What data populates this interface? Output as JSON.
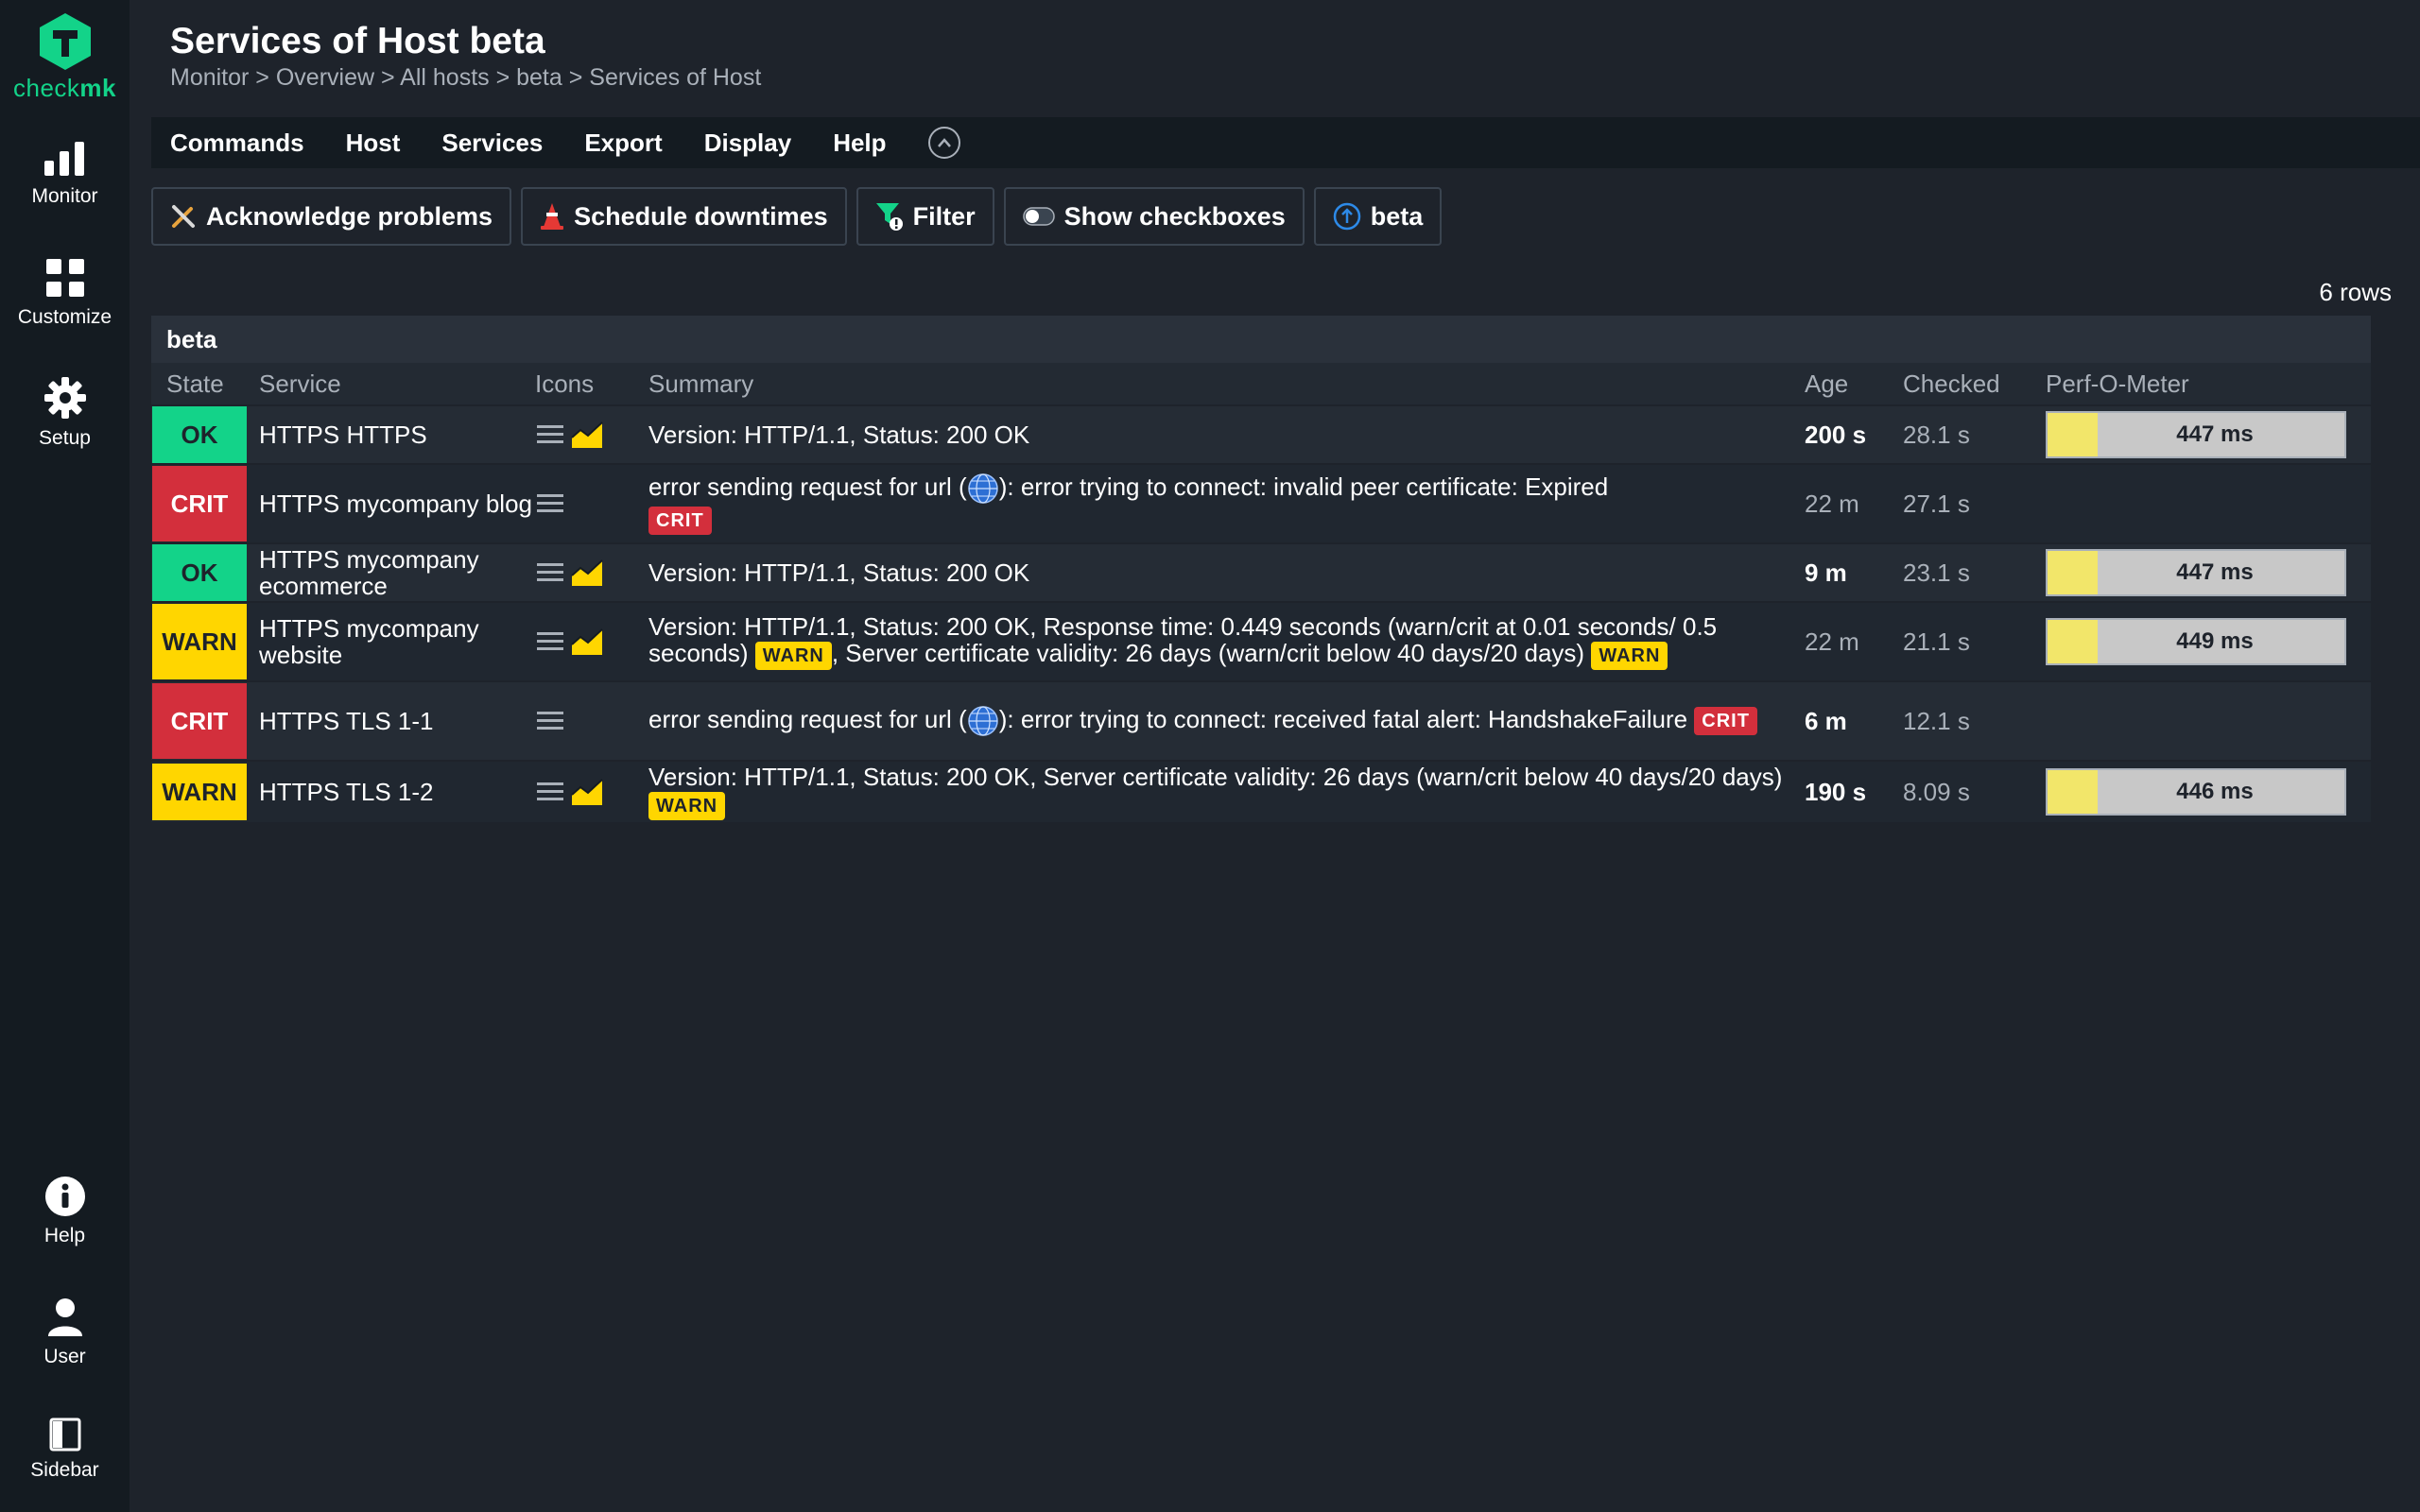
{
  "brand": {
    "check": "check",
    "mk": "mk"
  },
  "sidebar": {
    "items": [
      {
        "label": "Monitor",
        "icon": "bar-chart-icon"
      },
      {
        "label": "Customize",
        "icon": "grid-icon"
      },
      {
        "label": "Setup",
        "icon": "gear-icon"
      },
      {
        "label": "Help",
        "icon": "info-icon"
      },
      {
        "label": "User",
        "icon": "user-icon"
      },
      {
        "label": "Sidebar",
        "icon": "sidebar-icon"
      }
    ]
  },
  "header": {
    "title": "Services of Host beta",
    "breadcrumb": "Monitor > Overview > All hosts > beta > Services of Host"
  },
  "menubar": {
    "items": [
      "Commands",
      "Host",
      "Services",
      "Export",
      "Display",
      "Help"
    ]
  },
  "toolbar": {
    "acknowledge": "Acknowledge problems",
    "downtimes": "Schedule downtimes",
    "filter": "Filter",
    "checkboxes": "Show checkboxes",
    "host": "beta"
  },
  "table": {
    "row_count": "6 rows",
    "group": "beta",
    "columns": [
      "State",
      "Service",
      "Icons",
      "Summary",
      "Age",
      "Checked",
      "Perf-O-Meter"
    ],
    "rows": [
      {
        "state": "OK",
        "service": "HTTPS HTTPS",
        "summary": "Version: HTTP/1.1, Status: 200 OK",
        "age": "200 s",
        "checked": "28.1 s",
        "perf": "447 ms",
        "perf_fraction": 0.17
      },
      {
        "state": "CRIT",
        "service": "HTTPS mycompany blog",
        "summary_a": "error sending request for url (",
        "summary_b": "): error trying to connect: invalid peer certificate: Expired",
        "badge": "CRIT",
        "age": "22 m",
        "checked": "27.1 s"
      },
      {
        "state": "OK",
        "service": "HTTPS mycompany ecommerce",
        "summary": "Version: HTTP/1.1, Status: 200 OK",
        "age": "9 m",
        "checked": "23.1 s",
        "perf": "447 ms",
        "perf_fraction": 0.17
      },
      {
        "state": "WARN",
        "service": "HTTPS mycompany website",
        "summary_a": "Version: HTTP/1.1, Status: 200 OK, Response time: 0.449 seconds (warn/crit at 0.01 seconds/ 0.5 seconds)",
        "badge1": "WARN",
        "summary_b": ", Server certificate validity: 26 days (warn/crit below 40 days/20 days)",
        "badge2": "WARN",
        "age": "22 m",
        "checked": "21.1 s",
        "perf": "449 ms",
        "perf_fraction": 0.17
      },
      {
        "state": "CRIT",
        "service": "HTTPS TLS 1-1",
        "summary_a": "error sending request for url (",
        "summary_b": "): error trying to connect: received fatal alert: HandshakeFailure",
        "badge": "CRIT",
        "age": "6 m",
        "checked": "12.1 s"
      },
      {
        "state": "WARN",
        "service": "HTTPS TLS 1-2",
        "summary_a": "Version: HTTP/1.1, Status: 200 OK, Server certificate validity: 26 days (warn/crit below 40 days/20 days)",
        "badge": "WARN",
        "age": "190 s",
        "checked": "8.09 s",
        "perf": "446 ms",
        "perf_fraction": 0.17
      }
    ]
  },
  "colors": {
    "ok": "#13d389",
    "crit": "#d32f3c",
    "warn": "#ffd600",
    "perf_fill": "#f2e66a"
  }
}
